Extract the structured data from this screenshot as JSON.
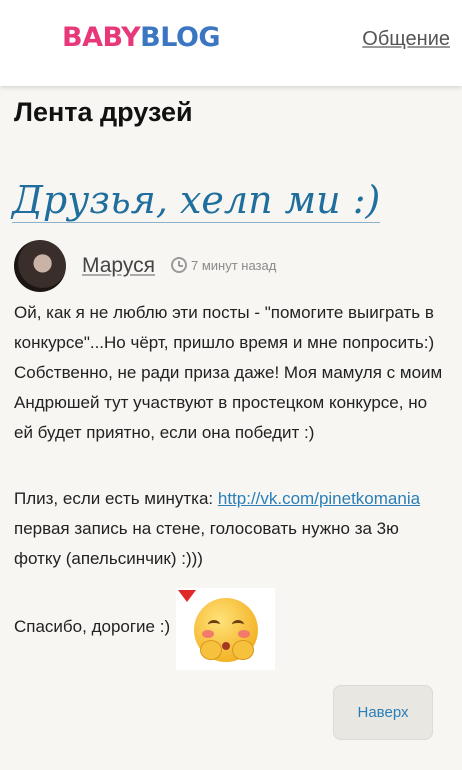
{
  "header": {
    "logo_part1": "BABY",
    "logo_part2": "BLOG",
    "nav_label": "Общение"
  },
  "section_title": "Лента друзей",
  "post": {
    "title": "Друзья, хелп ми :)",
    "author": "Маруся",
    "time": "7 минут назад",
    "paragraph1": "Ой, как я не люблю эти посты - \"помогите выиграть в конкурсе\"...Но чёрт, пришло время и мне попросить:) Собственно, не ради приза даже! Моя мамуля с моим Андрюшей тут участвуют в простецком конкурсе, но ей будет приятно, если она победит :)",
    "paragraph2_before": "Плиз, если есть минутка: ",
    "link_text": "http://vk.com/pinetkomania",
    "paragraph2_after": "  первая запись на стене, голосовать нужно за 3ю фотку (апельсинчик) :)))",
    "thanks": "Спасибо, дорогие :)"
  },
  "buttons": {
    "to_top": "Наверх"
  },
  "colors": {
    "brand_pink": "#e8387a",
    "brand_blue": "#3b76c2",
    "link": "#2a7fb8",
    "title": "#1f6e9e",
    "background": "#f7f6f2"
  },
  "icons": [
    "clock-icon",
    "emoji-sticker"
  ]
}
